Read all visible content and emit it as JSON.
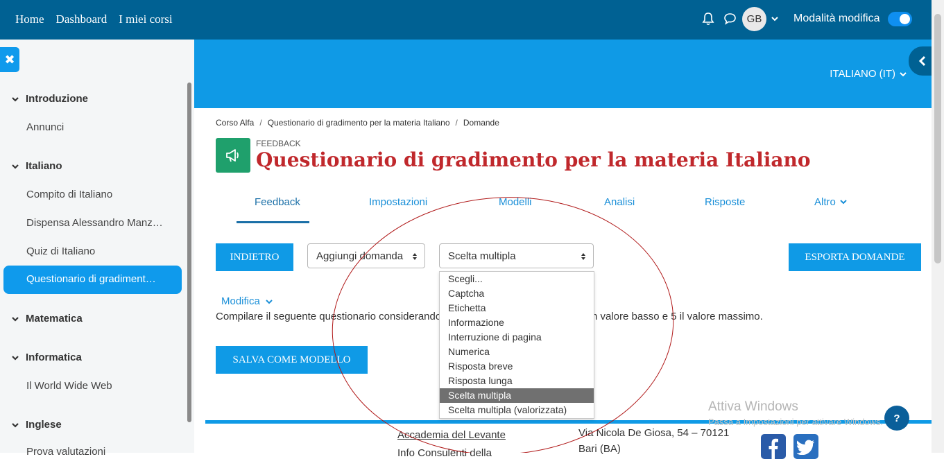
{
  "topbar": {
    "nav": [
      "Home",
      "Dashboard",
      "I miei corsi"
    ],
    "avatar_initials": "GB",
    "edit_mode_label": "Modalità modifica",
    "edit_mode_on": true
  },
  "sidebar": {
    "close_glyph": "✖",
    "sections": [
      {
        "label": "Introduzione",
        "items": [
          "Annunci"
        ]
      },
      {
        "label": "Italiano",
        "items": [
          "Compito di Italiano",
          "Dispensa Alessandro Manz…",
          "Quiz di Italiano",
          "Questionario di gradiment…"
        ]
      },
      {
        "label": "Matematica",
        "items": []
      },
      {
        "label": "Informatica",
        "items": [
          "Il World Wide Web"
        ]
      },
      {
        "label": "Inglese",
        "items": [
          "Prova valutazioni"
        ]
      }
    ],
    "active_item": "Questionario di gradiment…"
  },
  "banner": {
    "language": "ITALIANO (IT)"
  },
  "breadcrumb": [
    "Corso Alfa",
    "Questionario di gradimento per la materia Italiano",
    "Domande"
  ],
  "page": {
    "category": "FEEDBACK",
    "title": "Questionario di gradimento per la materia Italiano"
  },
  "tabs": [
    "Feedback",
    "Impostazioni",
    "Modelli",
    "Analisi",
    "Risposte",
    "Altro"
  ],
  "active_tab": "Feedback",
  "toolbar": {
    "back_label": "INDIETRO",
    "add_question_select": "Aggiungi domanda",
    "type_select": "Scelta multipla",
    "export_label": "ESPORTA DOMANDE"
  },
  "dropdown_options": [
    "Scegli...",
    "Captcha",
    "Etichetta",
    "Informazione",
    "Interruzione di pagina",
    "Numerica",
    "Risposta breve",
    "Risposta lunga",
    "Scelta multipla",
    "Scelta multipla (valorizzata)"
  ],
  "dropdown_selected": "Scelta multipla",
  "content": {
    "modifica_label": "Modifica",
    "description_left": "Compilare il seguente questionario considerando",
    "description_right": "n valore basso e 5 il valore massimo.",
    "save_template_label": "SALVA COME MODELLO"
  },
  "footer": {
    "org_name": "Accademia del Levante",
    "org_sub": "Info Consulenti della",
    "address": "Via Nicola De Giosa, 54 – 70121",
    "city": "Bari (BA)"
  },
  "windows_watermark": {
    "title": "Attiva Windows",
    "subtitle": "Passa a Impostazioni per attivare Windows."
  },
  "help_glyph": "?",
  "colors": {
    "topbar": "#006193",
    "banner": "#0f9ae6",
    "title_red": "#c0282c",
    "accent": "#0f9aec"
  }
}
